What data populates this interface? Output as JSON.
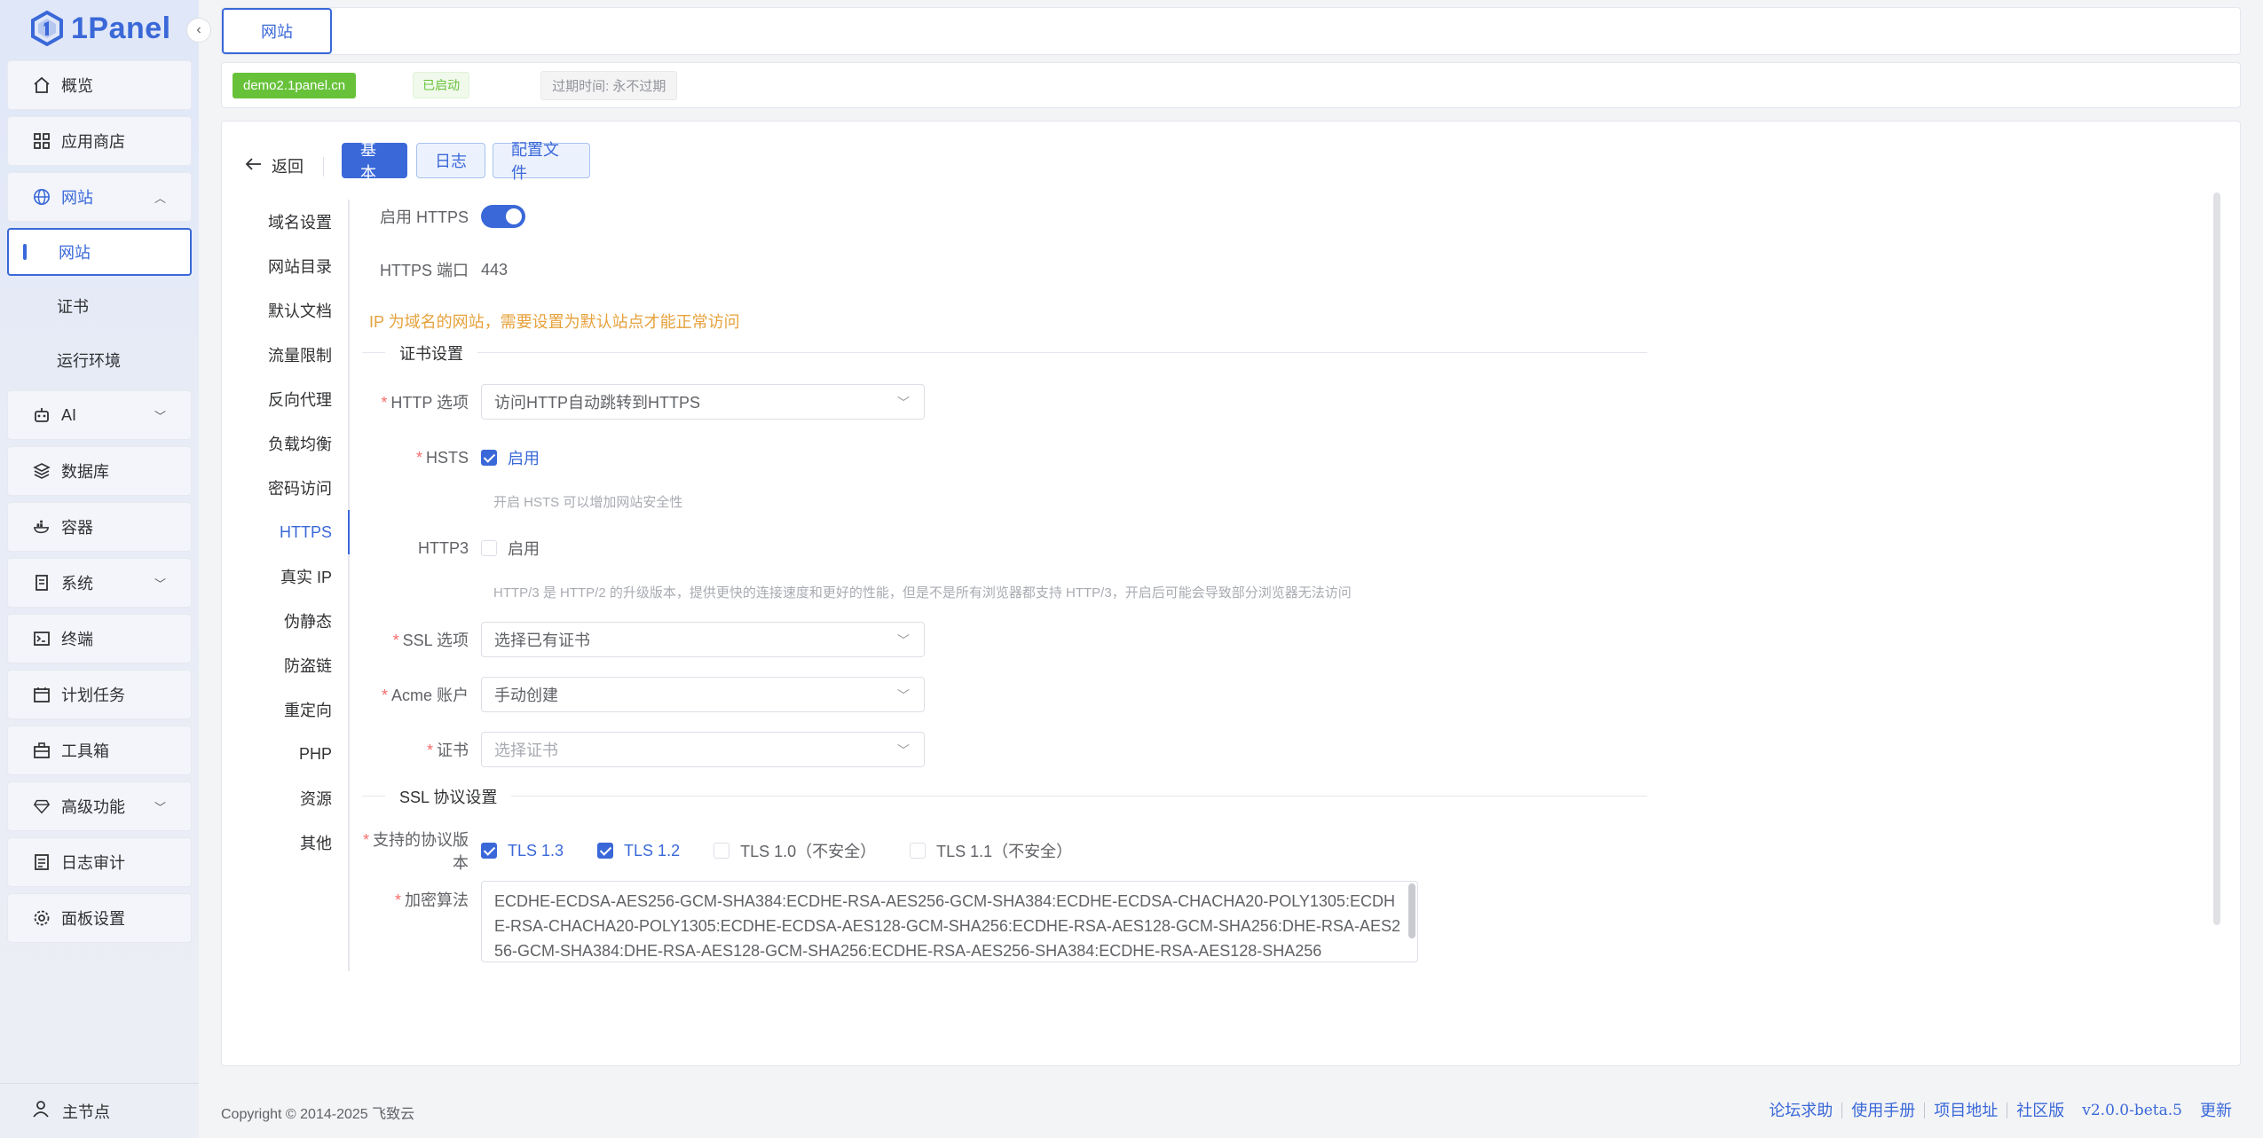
{
  "app": {
    "brand": "1Panel",
    "accent": "#3a68d8"
  },
  "sidebar": {
    "items": [
      {
        "label": "概览",
        "icon": "home-icon"
      },
      {
        "label": "应用商店",
        "icon": "grid-icon"
      },
      {
        "label": "网站",
        "icon": "globe-icon",
        "expanded": true,
        "children": [
          {
            "label": "网站",
            "active": true
          },
          {
            "label": "证书"
          },
          {
            "label": "运行环境"
          }
        ]
      },
      {
        "label": "AI",
        "icon": "robot-icon"
      },
      {
        "label": "数据库",
        "icon": "layers-icon"
      },
      {
        "label": "容器",
        "icon": "container-icon"
      },
      {
        "label": "系统",
        "icon": "server-icon"
      },
      {
        "label": "终端",
        "icon": "terminal-icon"
      },
      {
        "label": "计划任务",
        "icon": "calendar-icon"
      },
      {
        "label": "工具箱",
        "icon": "toolbox-icon"
      },
      {
        "label": "高级功能",
        "icon": "diamond-icon"
      },
      {
        "label": "日志审计",
        "icon": "log-icon"
      },
      {
        "label": "面板设置",
        "icon": "gear-icon"
      }
    ],
    "node": "主节点"
  },
  "top_tab": "网站",
  "info": {
    "domain": "demo2.1panel.cn",
    "status": "已启动",
    "expire": "过期时间: 永不过期"
  },
  "toolbar": {
    "back": "返回",
    "tab_basic": "基本",
    "tab_log": "日志",
    "tab_config": "配置文件"
  },
  "subnav": [
    "域名设置",
    "网站目录",
    "默认文档",
    "流量限制",
    "反向代理",
    "负载均衡",
    "密码访问",
    "HTTPS",
    "真实 IP",
    "伪静态",
    "防盗链",
    "重定向",
    "PHP",
    "资源",
    "其他"
  ],
  "form": {
    "https_label": "启用 HTTPS",
    "https_enabled": true,
    "port_label": "HTTPS 端口",
    "port_value": "443",
    "warning": "IP 为域名的网站，需要设置为默认站点才能正常访问",
    "cert_section": "证书设置",
    "http_option_label": "HTTP 选项",
    "http_option_value": "访问HTTP自动跳转到HTTPS",
    "hsts_label": "HSTS",
    "hsts_check": "启用",
    "hsts_checked": true,
    "hsts_hint": "开启 HSTS 可以增加网站安全性",
    "http3_label": "HTTP3",
    "http3_check": "启用",
    "http3_checked": false,
    "http3_hint": "HTTP/3 是 HTTP/2 的升级版本，提供更快的连接速度和更好的性能，但是不是所有浏览器都支持 HTTP/3，开启后可能会导致部分浏览器无法访问",
    "ssl_option_label": "SSL 选项",
    "ssl_option_value": "选择已有证书",
    "acme_label": "Acme 账户",
    "acme_value": "手动创建",
    "cert_label": "证书",
    "cert_placeholder": "选择证书",
    "ssl_section": "SSL 协议设置",
    "protocols_label": "支持的协议版本",
    "protocols": [
      {
        "label": "TLS 1.3",
        "checked": true
      },
      {
        "label": "TLS 1.2",
        "checked": true
      },
      {
        "label": "TLS 1.0（不安全）",
        "checked": false
      },
      {
        "label": "TLS 1.1（不安全）",
        "checked": false
      }
    ],
    "cipher_label": "加密算法",
    "cipher_value": "ECDHE-ECDSA-AES256-GCM-SHA384:ECDHE-RSA-AES256-GCM-SHA384:ECDHE-ECDSA-CHACHA20-POLY1305:ECDHE-RSA-CHACHA20-POLY1305:ECDHE-ECDSA-AES128-GCM-SHA256:ECDHE-RSA-AES128-GCM-SHA256:DHE-RSA-AES256-GCM-SHA384:DHE-RSA-AES128-GCM-SHA256:ECDHE-RSA-AES256-SHA384:ECDHE-RSA-AES128-SHA256"
  },
  "footer": {
    "copyright": "Copyright © 2014-2025 飞致云",
    "links": [
      "论坛求助",
      "使用手册",
      "项目地址",
      "社区版"
    ],
    "version": "v2.0.0-beta.5",
    "update": "更新"
  }
}
